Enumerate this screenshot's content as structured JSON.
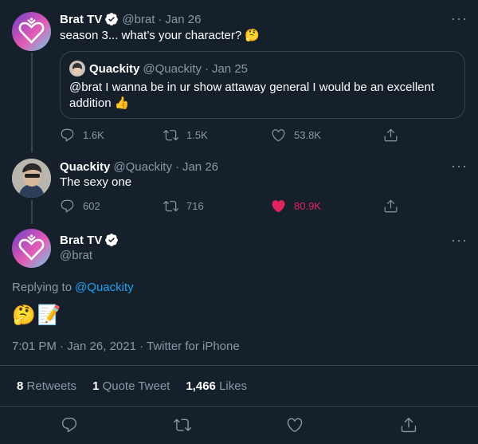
{
  "tweet1": {
    "name": "Brat TV",
    "handle": "@brat",
    "dot": "·",
    "date": "Jan 26",
    "text": "season 3... what’s your character? 🤔",
    "quote": {
      "name": "Quackity",
      "handle": "@Quackity",
      "dot": "·",
      "date": "Jan 25",
      "text": "@brat I wanna be in ur show attaway general I would be an excellent addition 👍"
    },
    "actions": {
      "replies": "1.6K",
      "retweets": "1.5K",
      "likes": "53.8K"
    }
  },
  "tweet2": {
    "name": "Quackity",
    "handle": "@Quackity",
    "dot": "·",
    "date": "Jan 26",
    "text": "The sexy one",
    "actions": {
      "replies": "602",
      "retweets": "716",
      "likes": "80.9K"
    },
    "liked": true
  },
  "main": {
    "name": "Brat TV",
    "handle": "@brat",
    "replying_prefix": "Replying to",
    "replying_to": "@Quackity",
    "text": "🤔📝",
    "timestamp": "7:01 PM · Jan 26, 2021 · Twitter for iPhone",
    "stats": {
      "retweets_count": "8",
      "retweets_label": "Retweets",
      "quotes_count": "1",
      "quotes_label": "Quote Tweet",
      "likes_count": "1,466",
      "likes_label": "Likes"
    }
  },
  "colors": {
    "background": "#15202b",
    "border": "#38444d",
    "muted": "#8899a6",
    "link": "#1da1f2",
    "like": "#e0245e"
  },
  "icons": [
    "more-icon",
    "reply-icon",
    "retweet-icon",
    "like-icon",
    "share-icon",
    "verified-icon",
    "heart-logo-icon"
  ]
}
